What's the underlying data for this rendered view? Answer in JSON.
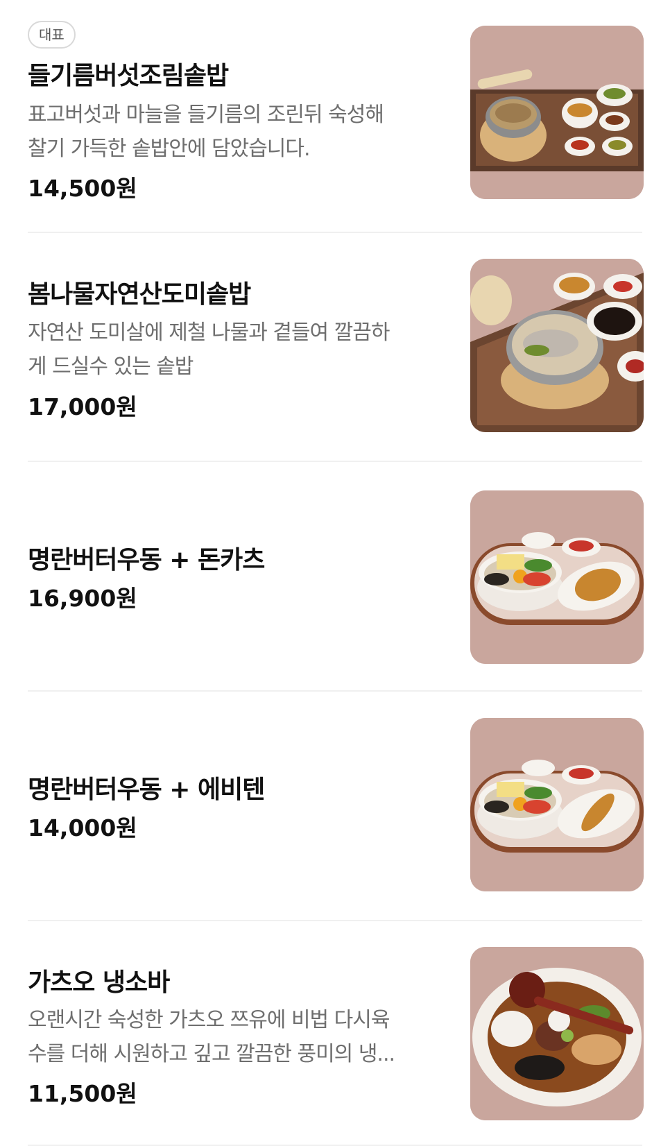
{
  "items": [
    {
      "badge": "대표",
      "name": "들기름버섯조림솥밥",
      "desc": [
        "표고버섯과 마늘을 들기름의 조린뒤 숙성해",
        "찰기 가득한 솥밥안에 담았습니다."
      ],
      "price": "14,500원",
      "photo": "dish-photo-perilla-mushroom-pot-rice"
    },
    {
      "name": "봄나물자연산도미솥밥",
      "desc": [
        "자연산 도미살에 제철 나물과 곁들여 깔끔하",
        "게 드실수 있는 솥밥"
      ],
      "price": "17,000원",
      "photo": "dish-photo-sea-bream-pot-rice"
    },
    {
      "name": "명란버터우동 + 돈카츠",
      "price": "16,900원",
      "photo": "dish-photo-mentaiko-udon-tonkatsu"
    },
    {
      "name": "명란버터우동 + 에비텐",
      "price": "14,000원",
      "photo": "dish-photo-mentaiko-udon-ebiten"
    },
    {
      "name": "가츠오 냉소바",
      "desc": [
        "오랜시간 숙성한 가츠오 쯔유에 비법 다시육",
        "수를 더해 시원하고 깊고 깔끔한 풍미의 냉..."
      ],
      "price": "11,500원",
      "photo": "dish-photo-katsuo-cold-soba"
    }
  ],
  "colors": {
    "photo_background": "#c8a79f",
    "divider": "#f0f0f0",
    "text_primary": "#111111",
    "text_secondary": "#6e6e6e"
  }
}
